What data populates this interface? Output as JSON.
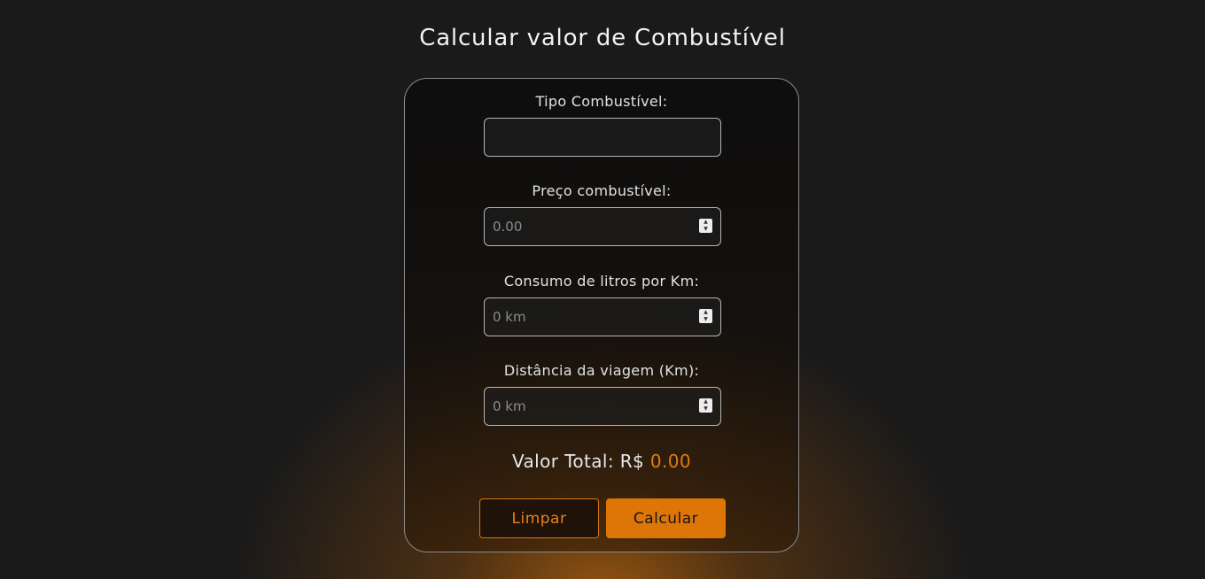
{
  "page": {
    "title": "Calcular valor de Combustível"
  },
  "form": {
    "fuel_type": {
      "label": "Tipo Combustível:",
      "value": "",
      "placeholder": ""
    },
    "fuel_price": {
      "label": "Preço combustível:",
      "value": "",
      "placeholder": "0.00"
    },
    "consumption": {
      "label": "Consumo de litros por Km:",
      "value": "",
      "placeholder": "0 km"
    },
    "distance": {
      "label": "Distância da viagem (Km):",
      "value": "",
      "placeholder": "0 km"
    }
  },
  "result": {
    "label": "Valor Total: R$",
    "value": "0.00"
  },
  "buttons": {
    "clear_label": "Limpar",
    "calculate_label": "Calcular"
  },
  "colors": {
    "background": "#1a1a1a",
    "accent": "#dd7607",
    "glow": "#be690f"
  }
}
